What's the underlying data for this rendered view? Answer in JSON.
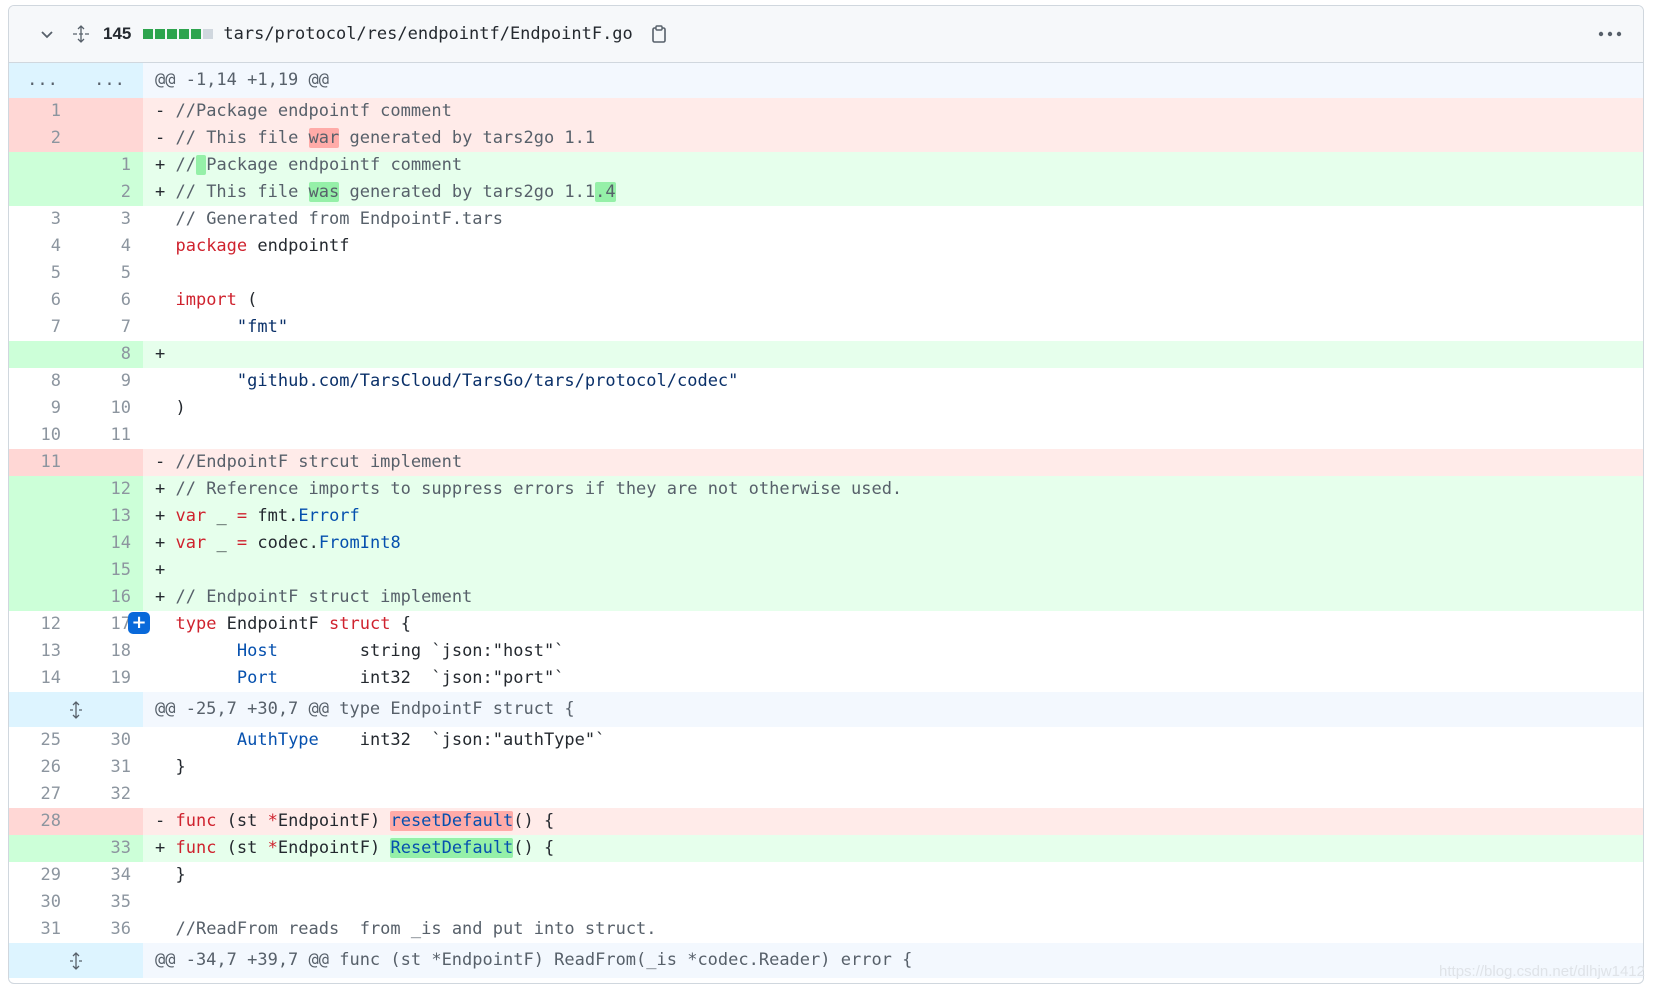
{
  "header": {
    "changes_count": "145",
    "file_path": "tars/protocol/res/endpointf/EndpointF.go",
    "diffstat_colors": [
      "#2da44e",
      "#2da44e",
      "#2da44e",
      "#2da44e",
      "#2da44e",
      "#d0d7de"
    ],
    "icons": [
      "chevron-down-icon",
      "unfold-icon",
      "copy-icon",
      "kebab-horizontal-icon"
    ]
  },
  "hunks": [
    {
      "dots_left": "...",
      "dots_right": "...",
      "header": "@@ -1,14 +1,19 @@"
    },
    {
      "header": "@@ -25,7 +30,7 @@ type EndpointF struct {"
    },
    {
      "header": "@@ -34,7 +39,7 @@ func (st *EndpointF) ReadFrom(_is *codec.Reader) error {"
    }
  ],
  "lines": [
    {
      "type": "del",
      "old": "1",
      "new": "",
      "segs": [
        [
          "- ",
          ""
        ],
        [
          "//Package endpointf comment",
          "cm"
        ]
      ]
    },
    {
      "type": "del",
      "old": "2",
      "new": "",
      "segs": [
        [
          "- ",
          ""
        ],
        [
          "// This file ",
          "cm"
        ],
        [
          "war",
          "cm hl-del"
        ],
        [
          " generated by tars2go 1.1",
          "cm"
        ]
      ]
    },
    {
      "type": "add",
      "old": "",
      "new": "1",
      "segs": [
        [
          "+ ",
          ""
        ],
        [
          "//",
          "cm"
        ],
        [
          " ",
          "cm hl-add"
        ],
        [
          "Package endpointf comment",
          "cm"
        ]
      ]
    },
    {
      "type": "add",
      "old": "",
      "new": "2",
      "segs": [
        [
          "+ ",
          ""
        ],
        [
          "// This file ",
          "cm"
        ],
        [
          "was",
          "cm hl-add"
        ],
        [
          " generated by tars2go 1.1",
          "cm"
        ],
        [
          ".4",
          "cm hl-add"
        ]
      ]
    },
    {
      "type": "ctx",
      "old": "3",
      "new": "3",
      "segs": [
        [
          "  ",
          ""
        ],
        [
          "// Generated from EndpointF.tars",
          "cm"
        ]
      ]
    },
    {
      "type": "ctx",
      "old": "4",
      "new": "4",
      "segs": [
        [
          "  ",
          ""
        ],
        [
          "package",
          "kw"
        ],
        [
          " endpointf",
          ""
        ]
      ]
    },
    {
      "type": "ctx",
      "old": "5",
      "new": "5",
      "segs": [
        [
          "",
          ""
        ]
      ]
    },
    {
      "type": "ctx",
      "old": "6",
      "new": "6",
      "segs": [
        [
          "  ",
          ""
        ],
        [
          "import",
          "kw"
        ],
        [
          " (",
          ""
        ]
      ]
    },
    {
      "type": "ctx",
      "old": "7",
      "new": "7",
      "segs": [
        [
          "        ",
          ""
        ],
        [
          "\"fmt\"",
          "str"
        ]
      ]
    },
    {
      "type": "add",
      "old": "",
      "new": "8",
      "segs": [
        [
          "+ ",
          ""
        ]
      ]
    },
    {
      "type": "ctx",
      "old": "8",
      "new": "9",
      "segs": [
        [
          "        ",
          ""
        ],
        [
          "\"github.com/TarsCloud/TarsGo/tars/protocol/codec\"",
          "str"
        ]
      ]
    },
    {
      "type": "ctx",
      "old": "9",
      "new": "10",
      "segs": [
        [
          "  )",
          ""
        ]
      ]
    },
    {
      "type": "ctx",
      "old": "10",
      "new": "11",
      "segs": [
        [
          "",
          ""
        ]
      ]
    },
    {
      "type": "del",
      "old": "11",
      "new": "",
      "segs": [
        [
          "- ",
          ""
        ],
        [
          "//EndpointF strcut implement",
          "cm"
        ]
      ]
    },
    {
      "type": "add",
      "old": "",
      "new": "12",
      "segs": [
        [
          "+ ",
          ""
        ],
        [
          "// Reference imports to suppress errors if they are not otherwise used.",
          "cm"
        ]
      ]
    },
    {
      "type": "add",
      "old": "",
      "new": "13",
      "segs": [
        [
          "+ ",
          ""
        ],
        [
          "var",
          "kw"
        ],
        [
          " _ ",
          ""
        ],
        [
          "=",
          "kw"
        ],
        [
          " fmt.",
          ""
        ],
        [
          "Errorf",
          "fn"
        ]
      ]
    },
    {
      "type": "add",
      "old": "",
      "new": "14",
      "segs": [
        [
          "+ ",
          ""
        ],
        [
          "var",
          "kw"
        ],
        [
          " _ ",
          ""
        ],
        [
          "=",
          "kw"
        ],
        [
          " codec.",
          ""
        ],
        [
          "FromInt8",
          "fn"
        ]
      ]
    },
    {
      "type": "add",
      "old": "",
      "new": "15",
      "segs": [
        [
          "+ ",
          ""
        ]
      ]
    },
    {
      "type": "add",
      "old": "",
      "new": "16",
      "segs": [
        [
          "+ ",
          ""
        ],
        [
          "// EndpointF struct implement",
          "cm"
        ]
      ]
    },
    {
      "type": "ctx",
      "old": "12",
      "new": "17",
      "segs": [
        [
          "  ",
          ""
        ],
        [
          "type",
          "kw"
        ],
        [
          " EndpointF ",
          ""
        ],
        [
          "struct",
          "kw"
        ],
        [
          " {",
          ""
        ]
      ]
    },
    {
      "type": "ctx",
      "old": "13",
      "new": "18",
      "segs": [
        [
          "        ",
          ""
        ],
        [
          "Host",
          "fn"
        ],
        [
          "        string `json:\"host\"`",
          ""
        ]
      ]
    },
    {
      "type": "ctx",
      "old": "14",
      "new": "19",
      "segs": [
        [
          "        ",
          ""
        ],
        [
          "Port",
          "fn"
        ],
        [
          "        int32  `json:\"port\"`",
          ""
        ]
      ]
    },
    {
      "type": "hunk",
      "hunk": "1"
    },
    {
      "type": "ctx",
      "old": "25",
      "new": "30",
      "segs": [
        [
          "        ",
          ""
        ],
        [
          "AuthType",
          "fn"
        ],
        [
          "    int32  `json:\"authType\"`",
          ""
        ]
      ]
    },
    {
      "type": "ctx",
      "old": "26",
      "new": "31",
      "segs": [
        [
          "  }",
          ""
        ]
      ]
    },
    {
      "type": "ctx",
      "old": "27",
      "new": "32",
      "segs": [
        [
          "",
          ""
        ]
      ]
    },
    {
      "type": "del",
      "old": "28",
      "new": "",
      "segs": [
        [
          "- ",
          ""
        ],
        [
          "func",
          "kw"
        ],
        [
          " (st ",
          ""
        ],
        [
          "*",
          "kw"
        ],
        [
          "EndpointF) ",
          ""
        ],
        [
          "resetDefault",
          "fn hl-del"
        ],
        [
          "() {",
          ""
        ]
      ]
    },
    {
      "type": "add",
      "old": "",
      "new": "33",
      "segs": [
        [
          "+ ",
          ""
        ],
        [
          "func",
          "kw"
        ],
        [
          " (st ",
          ""
        ],
        [
          "*",
          "kw"
        ],
        [
          "EndpointF) ",
          ""
        ],
        [
          "ResetDefault",
          "fn hl-add"
        ],
        [
          "() {",
          ""
        ]
      ]
    },
    {
      "type": "ctx",
      "old": "29",
      "new": "34",
      "segs": [
        [
          "  }",
          ""
        ]
      ]
    },
    {
      "type": "ctx",
      "old": "30",
      "new": "35",
      "segs": [
        [
          "",
          ""
        ]
      ]
    },
    {
      "type": "ctx",
      "old": "31",
      "new": "36",
      "segs": [
        [
          "  ",
          ""
        ],
        [
          "//ReadFrom reads  from _is and put into struct.",
          "cm"
        ]
      ]
    },
    {
      "type": "hunk",
      "hunk": "2"
    }
  ],
  "watermark": "https://blog.csdn.net/dlhjw1412"
}
